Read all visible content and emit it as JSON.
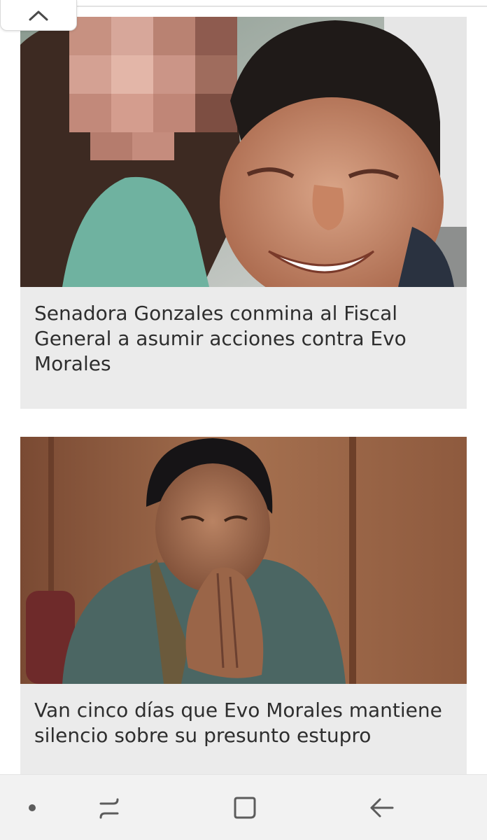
{
  "collapse_tab": {
    "icon": "chevron-up-icon"
  },
  "articles": [
    {
      "title": "Senadora Gonzales conmina al Fiscal General a asumir acciones contra Evo Morales"
    },
    {
      "title": "Van cinco días que Evo Morales mantiene silencio sobre su presunto estupro"
    }
  ],
  "navbar": {
    "buttons": [
      {
        "icon": "dot-icon"
      },
      {
        "icon": "recent-apps-icon"
      },
      {
        "icon": "home-icon"
      },
      {
        "icon": "back-arrow-icon"
      }
    ]
  },
  "colors": {
    "card_background": "#ebebeb",
    "title_text": "#2e2e2e",
    "navbar_background": "#f2f2f2",
    "navbar_icons": "#5c5c5c"
  }
}
